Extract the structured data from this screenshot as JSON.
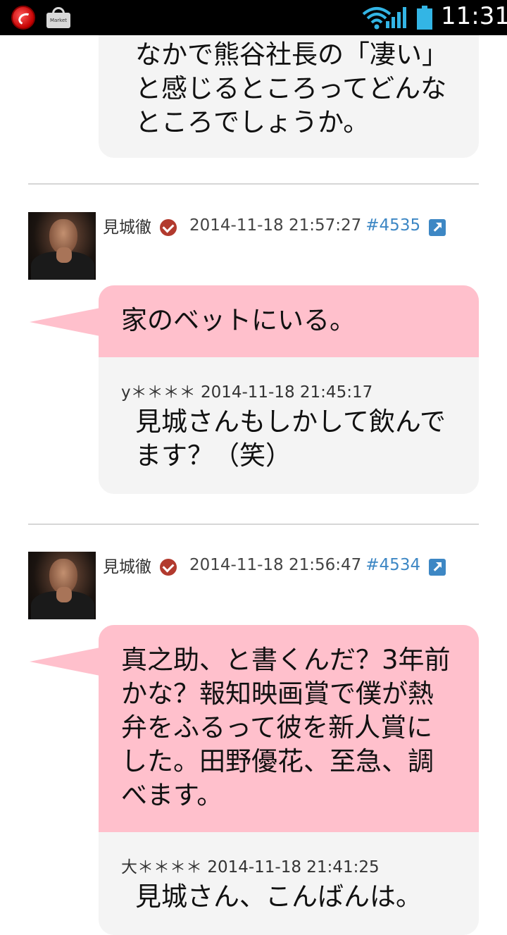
{
  "status_bar": {
    "time": "11:31",
    "app_icon_1": "trend-micro-icon",
    "app_icon_2": "market-icon",
    "app_icon_2_label": "Market",
    "wifi_icon": "wifi-icon",
    "signal_icon": "signal-icon",
    "battery_icon": "battery-icon",
    "accent": "#33b5e5"
  },
  "feed": {
    "top_partial": {
      "text": "なかで熊谷社長の「凄い」と感じるところってどんなところでしょうか。"
    },
    "posts": [
      {
        "author": "見城徹",
        "timestamp": "2014-11-18 21:57:27",
        "post_number": "#4535",
        "reply_text": "家のベットにいる。",
        "quote": {
          "author": "y＊＊＊＊",
          "timestamp": "2014-11-18 21:45:17",
          "text": "見城さんもしかして飲んでます？（笑）"
        }
      },
      {
        "author": "見城徹",
        "timestamp": "2014-11-18 21:56:47",
        "post_number": "#4534",
        "reply_text": "真之助、と書くんだ？3年前かな？報知映画賞で僕が熱弁をふるって彼を新人賞にした。田野優花、至急、調べます。",
        "quote": {
          "author": "大＊＊＊＊",
          "timestamp": "2014-11-18 21:41:25",
          "text": "見城さん、こんばんは。"
        }
      }
    ]
  },
  "colors": {
    "reply_bubble": "#ffc0cc",
    "quote_bubble": "#f4f4f4",
    "link": "#3d87c4",
    "verified": "#b23a2e"
  }
}
